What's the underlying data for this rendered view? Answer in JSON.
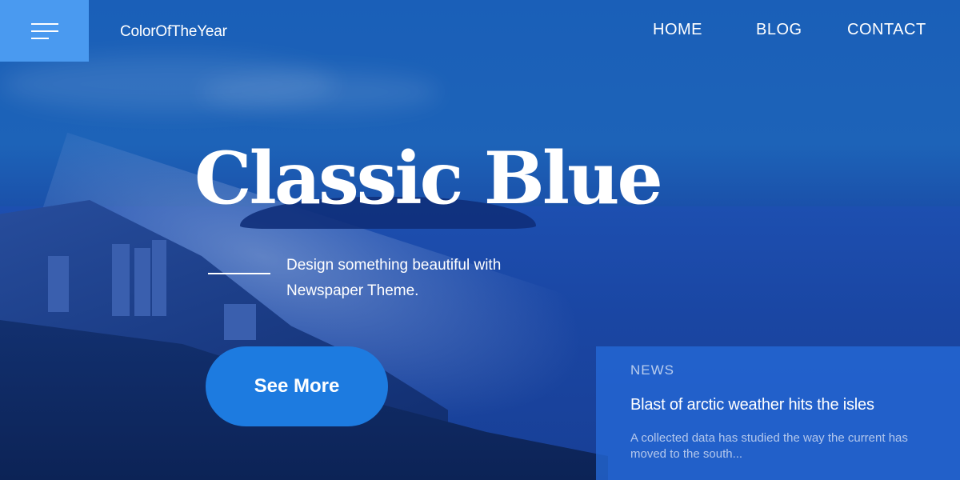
{
  "header": {
    "menu_icon": "hamburger-menu-icon",
    "brand": "ColorOfTheYear",
    "nav": [
      {
        "label": "HOME"
      },
      {
        "label": "BLOG"
      },
      {
        "label": "CONTACT"
      }
    ]
  },
  "hero": {
    "title": "Classic Blue",
    "subtitle": "Design something beautiful with Newspaper Theme.",
    "cta_label": "See More"
  },
  "news": {
    "tag": "NEWS",
    "headline": "Blast of arctic weather hits the isles",
    "excerpt": "A collected data has studied the way the current has moved to the south..."
  },
  "colors": {
    "menu_box": "#4a9af0",
    "cta": "#1d7be0",
    "news_panel": "#2569d7"
  }
}
